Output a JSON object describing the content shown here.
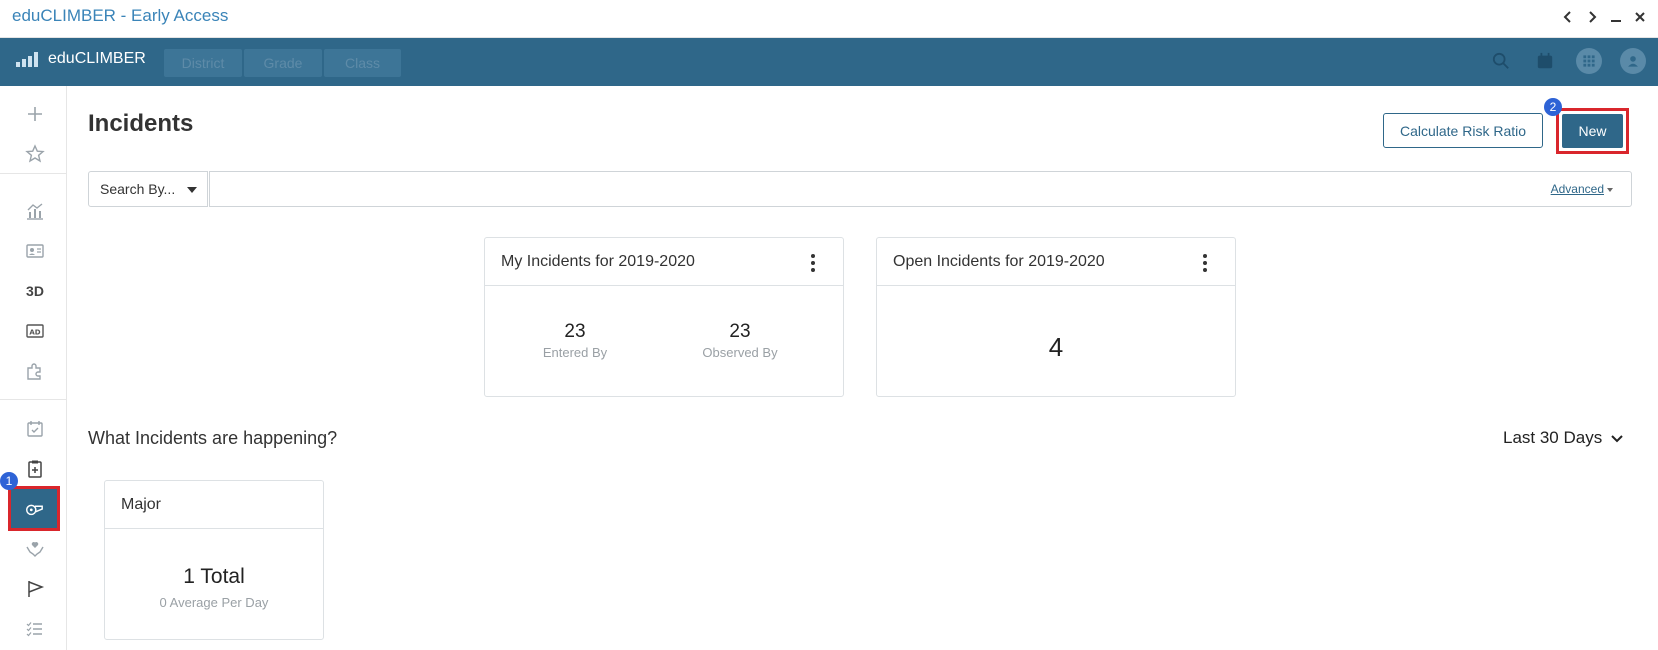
{
  "window": {
    "title": "eduCLIMBER - Early Access",
    "controls": [
      "back-icon",
      "forward-icon",
      "minimize-icon",
      "close-icon"
    ]
  },
  "header": {
    "brand": "eduCLIMBER",
    "context_tabs": [
      "District",
      "Grade",
      "Class"
    ],
    "icons": [
      "search-icon",
      "calendar-icon",
      "apps-grid-icon",
      "user-avatar-icon"
    ],
    "colors": {
      "bar": "#2f6789",
      "accent": "#2f6789",
      "highlight": "#d9262c",
      "badge": "#2e63d6"
    }
  },
  "sidebar": {
    "items": [
      {
        "icon": "plus-icon"
      },
      {
        "icon": "star-icon"
      },
      {
        "icon": "analytics-chart-icon"
      },
      {
        "icon": "student-id-card-icon"
      },
      {
        "icon": "3d-icon",
        "label": "3D"
      },
      {
        "icon": "ad-badge-icon"
      },
      {
        "icon": "puzzle-icon"
      },
      {
        "icon": "calendar-check-icon"
      },
      {
        "icon": "clipboard-plus-icon"
      },
      {
        "icon": "incidents-whistle-icon",
        "active": true,
        "badge": "1"
      },
      {
        "icon": "hands-heart-icon"
      },
      {
        "icon": "flag-icon"
      },
      {
        "icon": "checklist-icon"
      }
    ]
  },
  "main": {
    "title": "Incidents",
    "calculate_button": "Calculate Risk Ratio",
    "new_button": "New",
    "new_badge": "2",
    "search": {
      "by_label": "Search By...",
      "value": "",
      "advanced_label": "Advanced"
    },
    "cards": {
      "my_incidents": {
        "title": "My Incidents for 2019-2020",
        "stats": [
          {
            "value": "23",
            "label": "Entered By"
          },
          {
            "value": "23",
            "label": "Observed By"
          }
        ]
      },
      "open_incidents": {
        "title": "Open Incidents for 2019-2020",
        "value": "4"
      }
    },
    "happening": {
      "title": "What Incidents are happening?",
      "range": "Last 30 Days"
    },
    "major": {
      "title": "Major",
      "total": "1 Total",
      "average": "0 Average Per Day"
    }
  }
}
